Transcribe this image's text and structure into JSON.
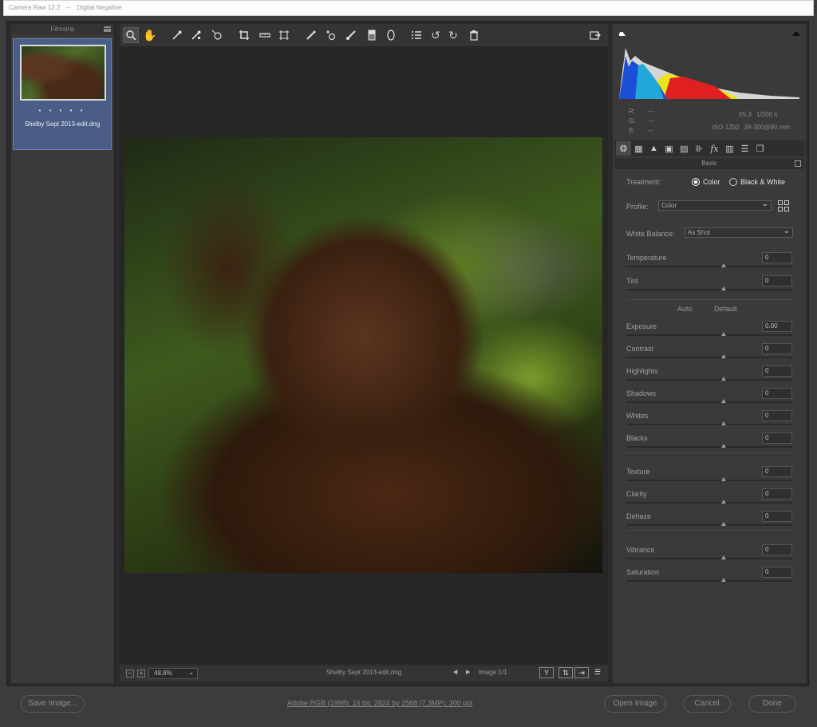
{
  "window": {
    "title": "Camera Raw 12.2",
    "subtitle": "Digital Negative"
  },
  "filmstrip": {
    "title": "Filmstrip",
    "items": [
      {
        "name": "Shelby Sept 2013-edit.dng",
        "stars": "• • • • •"
      }
    ]
  },
  "toolbar": {
    "tools": [
      "zoom-icon",
      "hand-icon",
      "white-balance-icon",
      "color-sampler-icon",
      "targeted-adjustment-icon",
      "crop-icon",
      "straighten-icon",
      "transform-icon",
      "spot-removal-icon",
      "red-eye-icon",
      "adjustment-brush-icon",
      "graduated-filter-icon",
      "radial-filter-icon",
      "preferences-icon",
      "rotate-left-icon",
      "rotate-right-icon",
      "trash-icon"
    ],
    "fullscreen": "fullscreen-icon"
  },
  "status": {
    "zoom": "48.8%",
    "filename": "Shelby Sept 2013-edit.dng",
    "image_count": "Image 1/1"
  },
  "info": {
    "r_label": "R:",
    "g_label": "G:",
    "b_label": "B:",
    "r": "---",
    "g": "---",
    "b": "---",
    "aperture": "f/5.3",
    "shutter": "1/200 s",
    "iso": "ISO 1250",
    "lens": "28-300@90 mm"
  },
  "panel": {
    "tabs": [
      "basic-icon",
      "tone-curve-icon",
      "detail-icon",
      "hsl-icon",
      "split-toning-icon",
      "lens-corrections-icon",
      "effects-icon",
      "camera-calibration-icon",
      "presets-icon",
      "snapshots-icon"
    ],
    "section_title": "Basic",
    "treatment_label": "Treatment:",
    "treatment_options": [
      "Color",
      "Black & White"
    ],
    "treatment_selected": "Color",
    "profile_label": "Profile:",
    "profile_value": "Color",
    "wb_label": "White Balance:",
    "wb_value": "As Shot",
    "auto": "Auto",
    "default": "Default",
    "sliders": [
      {
        "label": "Temperature",
        "value": "0"
      },
      {
        "label": "Tint",
        "value": "0"
      },
      {
        "label": "Exposure",
        "value": "0.00"
      },
      {
        "label": "Contrast",
        "value": "0"
      },
      {
        "label": "Highlights",
        "value": "0"
      },
      {
        "label": "Shadows",
        "value": "0"
      },
      {
        "label": "Whites",
        "value": "0"
      },
      {
        "label": "Blacks",
        "value": "0"
      },
      {
        "label": "Texture",
        "value": "0"
      },
      {
        "label": "Clarity",
        "value": "0"
      },
      {
        "label": "Dehaze",
        "value": "0"
      },
      {
        "label": "Vibrance",
        "value": "0"
      },
      {
        "label": "Saturation",
        "value": "0"
      }
    ]
  },
  "footer": {
    "save": "Save Image...",
    "info": "Adobe RGB (1998); 16 bit; 2824 by 2568 (7.3MP); 300 ppi",
    "open": "Open Image",
    "cancel": "Cancel",
    "done": "Done"
  },
  "colors": {
    "accent": "#4a5d87",
    "panel": "#3a3a3a",
    "canvas": "#262626"
  }
}
